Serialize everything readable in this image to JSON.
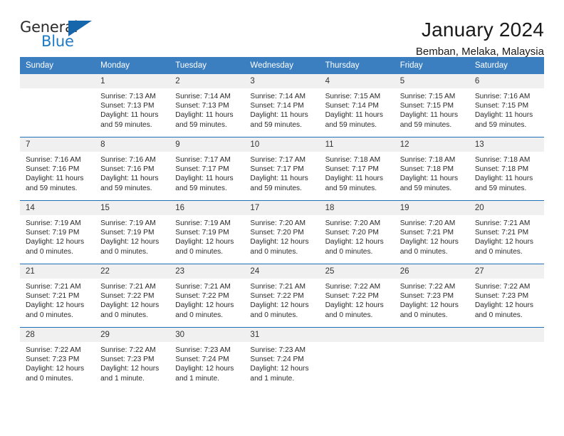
{
  "brand": {
    "name_top": "General",
    "name_bottom": "Blue",
    "accent_color": "#1566ab",
    "blue_text_color": "#1f7ac4"
  },
  "header": {
    "title": "January 2024",
    "subtitle": "Bemban, Melaka, Malaysia",
    "header_bg": "#3c7fc1",
    "row_divider": "#1f6fb5",
    "daynum_bg": "#f0f0f0"
  },
  "weekday_headers": [
    "Sunday",
    "Monday",
    "Tuesday",
    "Wednesday",
    "Thursday",
    "Friday",
    "Saturday"
  ],
  "weeks": [
    [
      {
        "day": "",
        "sunrise": "",
        "sunset": "",
        "daylight_1": "",
        "daylight_2": ""
      },
      {
        "day": "1",
        "sunrise": "Sunrise: 7:13 AM",
        "sunset": "Sunset: 7:13 PM",
        "daylight_1": "Daylight: 11 hours",
        "daylight_2": "and 59 minutes."
      },
      {
        "day": "2",
        "sunrise": "Sunrise: 7:14 AM",
        "sunset": "Sunset: 7:13 PM",
        "daylight_1": "Daylight: 11 hours",
        "daylight_2": "and 59 minutes."
      },
      {
        "day": "3",
        "sunrise": "Sunrise: 7:14 AM",
        "sunset": "Sunset: 7:14 PM",
        "daylight_1": "Daylight: 11 hours",
        "daylight_2": "and 59 minutes."
      },
      {
        "day": "4",
        "sunrise": "Sunrise: 7:15 AM",
        "sunset": "Sunset: 7:14 PM",
        "daylight_1": "Daylight: 11 hours",
        "daylight_2": "and 59 minutes."
      },
      {
        "day": "5",
        "sunrise": "Sunrise: 7:15 AM",
        "sunset": "Sunset: 7:15 PM",
        "daylight_1": "Daylight: 11 hours",
        "daylight_2": "and 59 minutes."
      },
      {
        "day": "6",
        "sunrise": "Sunrise: 7:16 AM",
        "sunset": "Sunset: 7:15 PM",
        "daylight_1": "Daylight: 11 hours",
        "daylight_2": "and 59 minutes."
      }
    ],
    [
      {
        "day": "7",
        "sunrise": "Sunrise: 7:16 AM",
        "sunset": "Sunset: 7:16 PM",
        "daylight_1": "Daylight: 11 hours",
        "daylight_2": "and 59 minutes."
      },
      {
        "day": "8",
        "sunrise": "Sunrise: 7:16 AM",
        "sunset": "Sunset: 7:16 PM",
        "daylight_1": "Daylight: 11 hours",
        "daylight_2": "and 59 minutes."
      },
      {
        "day": "9",
        "sunrise": "Sunrise: 7:17 AM",
        "sunset": "Sunset: 7:17 PM",
        "daylight_1": "Daylight: 11 hours",
        "daylight_2": "and 59 minutes."
      },
      {
        "day": "10",
        "sunrise": "Sunrise: 7:17 AM",
        "sunset": "Sunset: 7:17 PM",
        "daylight_1": "Daylight: 11 hours",
        "daylight_2": "and 59 minutes."
      },
      {
        "day": "11",
        "sunrise": "Sunrise: 7:18 AM",
        "sunset": "Sunset: 7:17 PM",
        "daylight_1": "Daylight: 11 hours",
        "daylight_2": "and 59 minutes."
      },
      {
        "day": "12",
        "sunrise": "Sunrise: 7:18 AM",
        "sunset": "Sunset: 7:18 PM",
        "daylight_1": "Daylight: 11 hours",
        "daylight_2": "and 59 minutes."
      },
      {
        "day": "13",
        "sunrise": "Sunrise: 7:18 AM",
        "sunset": "Sunset: 7:18 PM",
        "daylight_1": "Daylight: 11 hours",
        "daylight_2": "and 59 minutes."
      }
    ],
    [
      {
        "day": "14",
        "sunrise": "Sunrise: 7:19 AM",
        "sunset": "Sunset: 7:19 PM",
        "daylight_1": "Daylight: 12 hours",
        "daylight_2": "and 0 minutes."
      },
      {
        "day": "15",
        "sunrise": "Sunrise: 7:19 AM",
        "sunset": "Sunset: 7:19 PM",
        "daylight_1": "Daylight: 12 hours",
        "daylight_2": "and 0 minutes."
      },
      {
        "day": "16",
        "sunrise": "Sunrise: 7:19 AM",
        "sunset": "Sunset: 7:19 PM",
        "daylight_1": "Daylight: 12 hours",
        "daylight_2": "and 0 minutes."
      },
      {
        "day": "17",
        "sunrise": "Sunrise: 7:20 AM",
        "sunset": "Sunset: 7:20 PM",
        "daylight_1": "Daylight: 12 hours",
        "daylight_2": "and 0 minutes."
      },
      {
        "day": "18",
        "sunrise": "Sunrise: 7:20 AM",
        "sunset": "Sunset: 7:20 PM",
        "daylight_1": "Daylight: 12 hours",
        "daylight_2": "and 0 minutes."
      },
      {
        "day": "19",
        "sunrise": "Sunrise: 7:20 AM",
        "sunset": "Sunset: 7:21 PM",
        "daylight_1": "Daylight: 12 hours",
        "daylight_2": "and 0 minutes."
      },
      {
        "day": "20",
        "sunrise": "Sunrise: 7:21 AM",
        "sunset": "Sunset: 7:21 PM",
        "daylight_1": "Daylight: 12 hours",
        "daylight_2": "and 0 minutes."
      }
    ],
    [
      {
        "day": "21",
        "sunrise": "Sunrise: 7:21 AM",
        "sunset": "Sunset: 7:21 PM",
        "daylight_1": "Daylight: 12 hours",
        "daylight_2": "and 0 minutes."
      },
      {
        "day": "22",
        "sunrise": "Sunrise: 7:21 AM",
        "sunset": "Sunset: 7:22 PM",
        "daylight_1": "Daylight: 12 hours",
        "daylight_2": "and 0 minutes."
      },
      {
        "day": "23",
        "sunrise": "Sunrise: 7:21 AM",
        "sunset": "Sunset: 7:22 PM",
        "daylight_1": "Daylight: 12 hours",
        "daylight_2": "and 0 minutes."
      },
      {
        "day": "24",
        "sunrise": "Sunrise: 7:21 AM",
        "sunset": "Sunset: 7:22 PM",
        "daylight_1": "Daylight: 12 hours",
        "daylight_2": "and 0 minutes."
      },
      {
        "day": "25",
        "sunrise": "Sunrise: 7:22 AM",
        "sunset": "Sunset: 7:22 PM",
        "daylight_1": "Daylight: 12 hours",
        "daylight_2": "and 0 minutes."
      },
      {
        "day": "26",
        "sunrise": "Sunrise: 7:22 AM",
        "sunset": "Sunset: 7:23 PM",
        "daylight_1": "Daylight: 12 hours",
        "daylight_2": "and 0 minutes."
      },
      {
        "day": "27",
        "sunrise": "Sunrise: 7:22 AM",
        "sunset": "Sunset: 7:23 PM",
        "daylight_1": "Daylight: 12 hours",
        "daylight_2": "and 0 minutes."
      }
    ],
    [
      {
        "day": "28",
        "sunrise": "Sunrise: 7:22 AM",
        "sunset": "Sunset: 7:23 PM",
        "daylight_1": "Daylight: 12 hours",
        "daylight_2": "and 0 minutes."
      },
      {
        "day": "29",
        "sunrise": "Sunrise: 7:22 AM",
        "sunset": "Sunset: 7:23 PM",
        "daylight_1": "Daylight: 12 hours",
        "daylight_2": "and 1 minute."
      },
      {
        "day": "30",
        "sunrise": "Sunrise: 7:23 AM",
        "sunset": "Sunset: 7:24 PM",
        "daylight_1": "Daylight: 12 hours",
        "daylight_2": "and 1 minute."
      },
      {
        "day": "31",
        "sunrise": "Sunrise: 7:23 AM",
        "sunset": "Sunset: 7:24 PM",
        "daylight_1": "Daylight: 12 hours",
        "daylight_2": "and 1 minute."
      },
      {
        "day": "",
        "sunrise": "",
        "sunset": "",
        "daylight_1": "",
        "daylight_2": ""
      },
      {
        "day": "",
        "sunrise": "",
        "sunset": "",
        "daylight_1": "",
        "daylight_2": ""
      },
      {
        "day": "",
        "sunrise": "",
        "sunset": "",
        "daylight_1": "",
        "daylight_2": ""
      }
    ]
  ]
}
